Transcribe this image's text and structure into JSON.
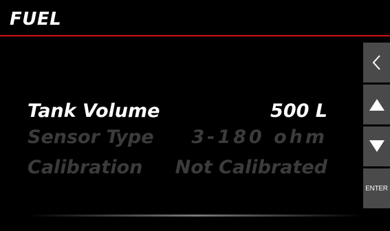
{
  "header": {
    "title": "FUEL",
    "accent_color": "#d21414"
  },
  "settings": [
    {
      "label": "Tank Volume",
      "value": "500 L",
      "selected": true
    },
    {
      "label": "Sensor Type",
      "value": "3-180 ohm",
      "selected": false
    },
    {
      "label": "Calibration",
      "value": "Not Calibrated",
      "selected": false
    }
  ],
  "side_buttons": {
    "back_icon": "chevron-left-icon",
    "up_icon": "triangle-up-icon",
    "down_icon": "triangle-down-icon",
    "enter_label": "ENTER"
  }
}
